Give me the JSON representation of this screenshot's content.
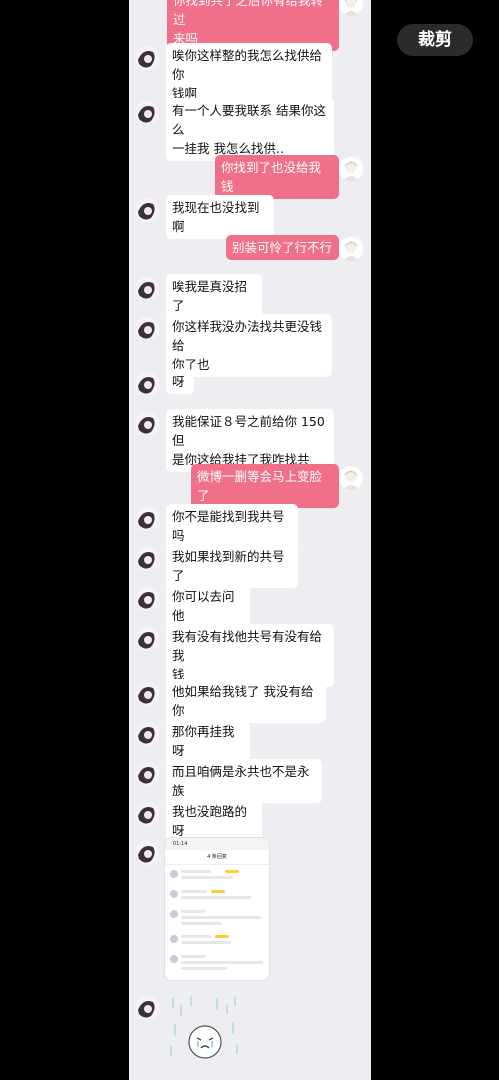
{
  "toolbar": {
    "crop_label": "裁剪"
  },
  "messages": [
    {
      "side": "right",
      "text": "你找到共了之后你有给我转过\n来吗"
    },
    {
      "side": "left",
      "text": "唉你这样整的我怎么找供给你\n钱啊"
    },
    {
      "side": "left",
      "text": "有一个人要我联系 结果你这么\n一挂我 我怎么找供.."
    },
    {
      "side": "right",
      "text": "你找到了也没给我钱"
    },
    {
      "side": "left",
      "text": "我现在也没找到啊"
    },
    {
      "side": "right",
      "text": "别装可怜了行不行"
    },
    {
      "side": "left",
      "text": "唉我是真没招了"
    },
    {
      "side": "left",
      "text": "你这样我没办法找共更没钱给\n你了也"
    },
    {
      "side": "left",
      "text": "呀"
    },
    {
      "side": "left",
      "text": "我能保证８号之前给你 150 但\n是你这给我挂了我咋找共"
    },
    {
      "side": "right",
      "text": "微博一删等会马上变脸了"
    },
    {
      "side": "left",
      "text": "你不是能找到我共号吗"
    },
    {
      "side": "left",
      "text": "我如果找到新的共号了"
    },
    {
      "side": "left",
      "text": "你可以去问他"
    },
    {
      "side": "left",
      "text": "我有没有找他共号有没有给我\n钱"
    },
    {
      "side": "left",
      "text": "他如果给我钱了 我没有给你"
    },
    {
      "side": "left",
      "text": "那你再挂我呀"
    },
    {
      "side": "left",
      "text": "而且咱俩是永共也不是永族"
    },
    {
      "side": "left",
      "text": "我也没跑路的呀"
    }
  ],
  "screenshot": {
    "time": "01:14",
    "title": "4 条回复"
  },
  "colors": {
    "outgoing_bubble": "#f0708a",
    "incoming_bubble": "#ffffff",
    "chat_bg": "#eeeef2"
  },
  "icons": {
    "avatar": "anime-avatar-icon",
    "sticker": "crying-sticker-icon"
  }
}
